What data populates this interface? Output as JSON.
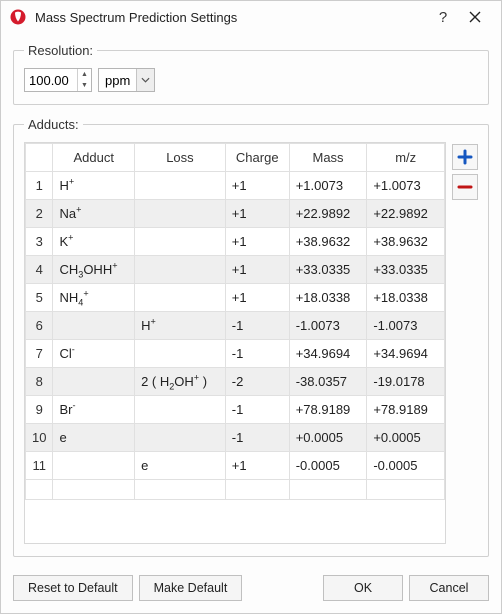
{
  "window": {
    "title": "Mass Spectrum Prediction Settings"
  },
  "resolution": {
    "legend": "Resolution:",
    "value": "100.00",
    "unit": "ppm"
  },
  "adducts": {
    "legend": "Adducts:",
    "columns": {
      "c0": "",
      "c1": "Adduct",
      "c2": "Loss",
      "c3": "Charge",
      "c4": "Mass",
      "c5": "m/z"
    },
    "rows": [
      {
        "n": "1",
        "adduct": "H<sup>+</sup>",
        "loss": "",
        "charge": "+1",
        "mass": "+1.0073",
        "mz": "+1.0073"
      },
      {
        "n": "2",
        "adduct": "Na<sup>+</sup>",
        "loss": "",
        "charge": "+1",
        "mass": "+22.9892",
        "mz": "+22.9892"
      },
      {
        "n": "3",
        "adduct": "K<sup>+</sup>",
        "loss": "",
        "charge": "+1",
        "mass": "+38.9632",
        "mz": "+38.9632"
      },
      {
        "n": "4",
        "adduct": "CH<sub>3</sub>OHH<sup>+</sup>",
        "loss": "",
        "charge": "+1",
        "mass": "+33.0335",
        "mz": "+33.0335"
      },
      {
        "n": "5",
        "adduct": "NH<sub>4</sub><sup>+</sup>",
        "loss": "",
        "charge": "+1",
        "mass": "+18.0338",
        "mz": "+18.0338"
      },
      {
        "n": "6",
        "adduct": "",
        "loss": "H<sup>+</sup>",
        "charge": "-1",
        "mass": "-1.0073",
        "mz": "-1.0073"
      },
      {
        "n": "7",
        "adduct": "Cl<sup>-</sup>",
        "loss": "",
        "charge": "-1",
        "mass": "+34.9694",
        "mz": "+34.9694"
      },
      {
        "n": "8",
        "adduct": "",
        "loss": "2 ( H<sub>2</sub>OH<sup>+</sup> )",
        "charge": "-2",
        "mass": "-38.0357",
        "mz": "-19.0178"
      },
      {
        "n": "9",
        "adduct": "Br<sup>-</sup>",
        "loss": "",
        "charge": "-1",
        "mass": "+78.9189",
        "mz": "+78.9189"
      },
      {
        "n": "10",
        "adduct": "e",
        "loss": "",
        "charge": "-1",
        "mass": "+0.0005",
        "mz": "+0.0005"
      },
      {
        "n": "11",
        "adduct": "",
        "loss": "e",
        "charge": "+1",
        "mass": "-0.0005",
        "mz": "-0.0005"
      }
    ]
  },
  "buttons": {
    "reset": "Reset to Default",
    "make": "Make Default",
    "ok": "OK",
    "cancel": "Cancel"
  }
}
